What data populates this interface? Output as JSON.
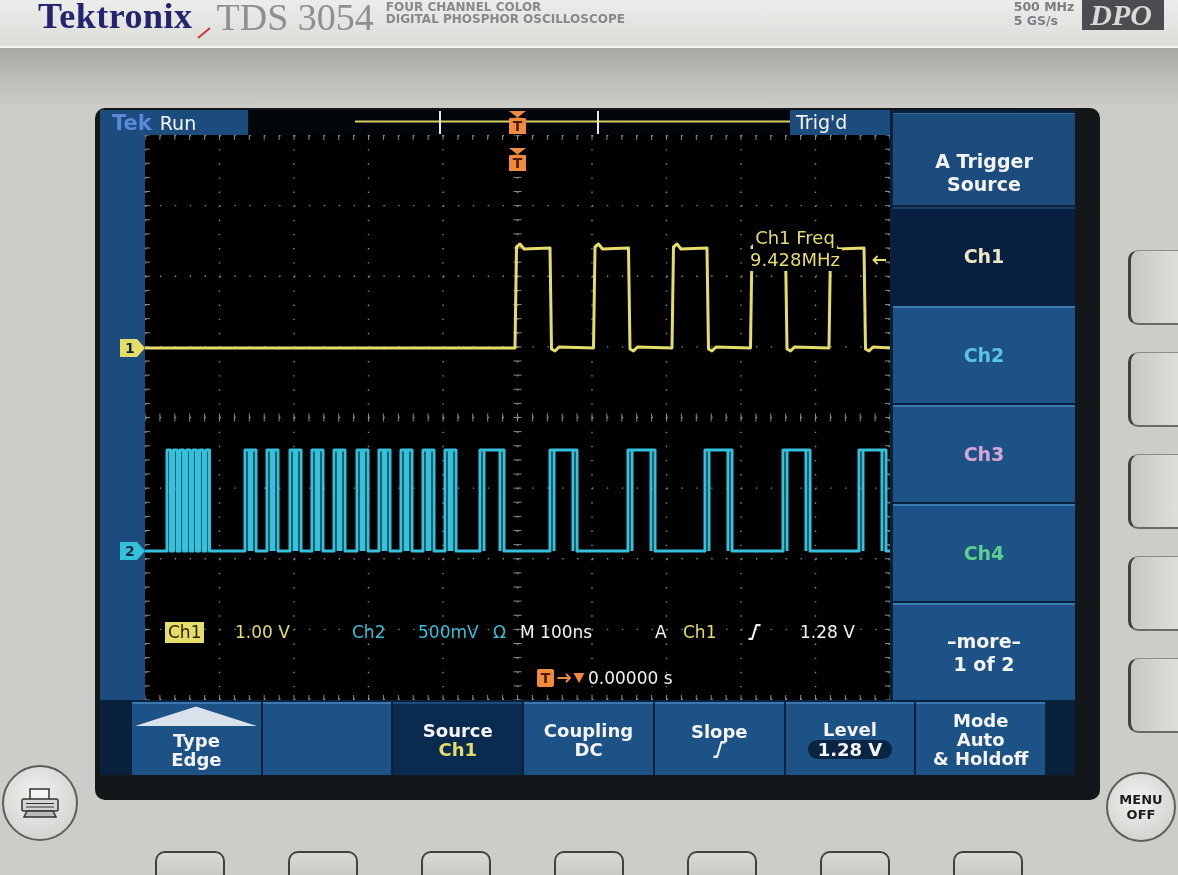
{
  "header": {
    "brand": "Tektronix",
    "model": "TDS 3054",
    "subtitle_lines": [
      "FOUR CHANNEL COLOR",
      "DIGITAL PHOSPHOR OSCILLOSCOPE"
    ],
    "specs": [
      "500 MHz",
      "5 GS/s"
    ],
    "badge": "DPO"
  },
  "screen": {
    "top_bar": {
      "logo": "Tek",
      "acquisition": "Run",
      "trigger_marker": "T",
      "trigger_status": "Trig'd"
    },
    "graticule": {
      "trigger_marker": "T",
      "channel_markers": [
        {
          "label": "1",
          "color": "#e6dc6a"
        },
        {
          "label": "2",
          "color": "#35c0dc"
        }
      ],
      "measurement": {
        "label": "Ch1 Freq",
        "value": "9.428MHz"
      }
    },
    "status": [
      {
        "kind": "tag",
        "text": "Ch1",
        "color": "#e6dc6a"
      },
      {
        "kind": "text",
        "text": "1.00 V",
        "color": "#e6dc6a"
      },
      {
        "kind": "text",
        "text": "Ch2",
        "color": "#35c0dc"
      },
      {
        "kind": "text",
        "text": "500mV",
        "color": "#35c0dc"
      },
      {
        "kind": "text",
        "text": "Ω",
        "color": "#35c0dc"
      },
      {
        "kind": "text",
        "text": "M 100ns",
        "color": "#f2f2f2"
      },
      {
        "kind": "text",
        "text": "A",
        "color": "#f2f2f2"
      },
      {
        "kind": "text",
        "text": "Ch1",
        "color": "#e6dc6a"
      },
      {
        "kind": "slope"
      },
      {
        "kind": "text",
        "text": "1.28 V",
        "color": "#f2f2f2"
      }
    ],
    "delay": {
      "marker": "T",
      "value": "0.00000 s"
    },
    "side_menu": {
      "title": "A Trigger Source",
      "items": [
        {
          "label": "Ch1",
          "selected": true,
          "color": "#efe6c8"
        },
        {
          "label": "Ch2",
          "selected": false,
          "color": "#5cc4e0"
        },
        {
          "label": "Ch3",
          "selected": false,
          "color": "#d6a6d6"
        },
        {
          "label": "Ch4",
          "selected": false,
          "color": "#5fcf8c"
        }
      ],
      "more": {
        "label": "–more–",
        "page": "1 of 2"
      }
    },
    "bottom_menu": [
      {
        "kind": "text",
        "label": "Type",
        "value": "Edge",
        "popup": true,
        "selected": false
      },
      {
        "kind": "blank",
        "popup": false,
        "selected": false
      },
      {
        "kind": "text",
        "label": "Source",
        "value": "Ch1",
        "popup": false,
        "selected": true,
        "color": "#e6dc6a"
      },
      {
        "kind": "text",
        "label": "Coupling",
        "value": "DC",
        "popup": false,
        "selected": false
      },
      {
        "kind": "slope",
        "label": "Slope",
        "popup": false,
        "selected": false
      },
      {
        "kind": "oval",
        "label": "Level",
        "value": "1.28 V",
        "popup": false,
        "selected": false
      },
      {
        "kind": "text",
        "label": "Mode",
        "value": "Auto",
        "suffix": "& Holdoff",
        "popup": false,
        "selected": false
      }
    ]
  },
  "front_panel": {
    "menu_off": "MENU OFF"
  }
}
